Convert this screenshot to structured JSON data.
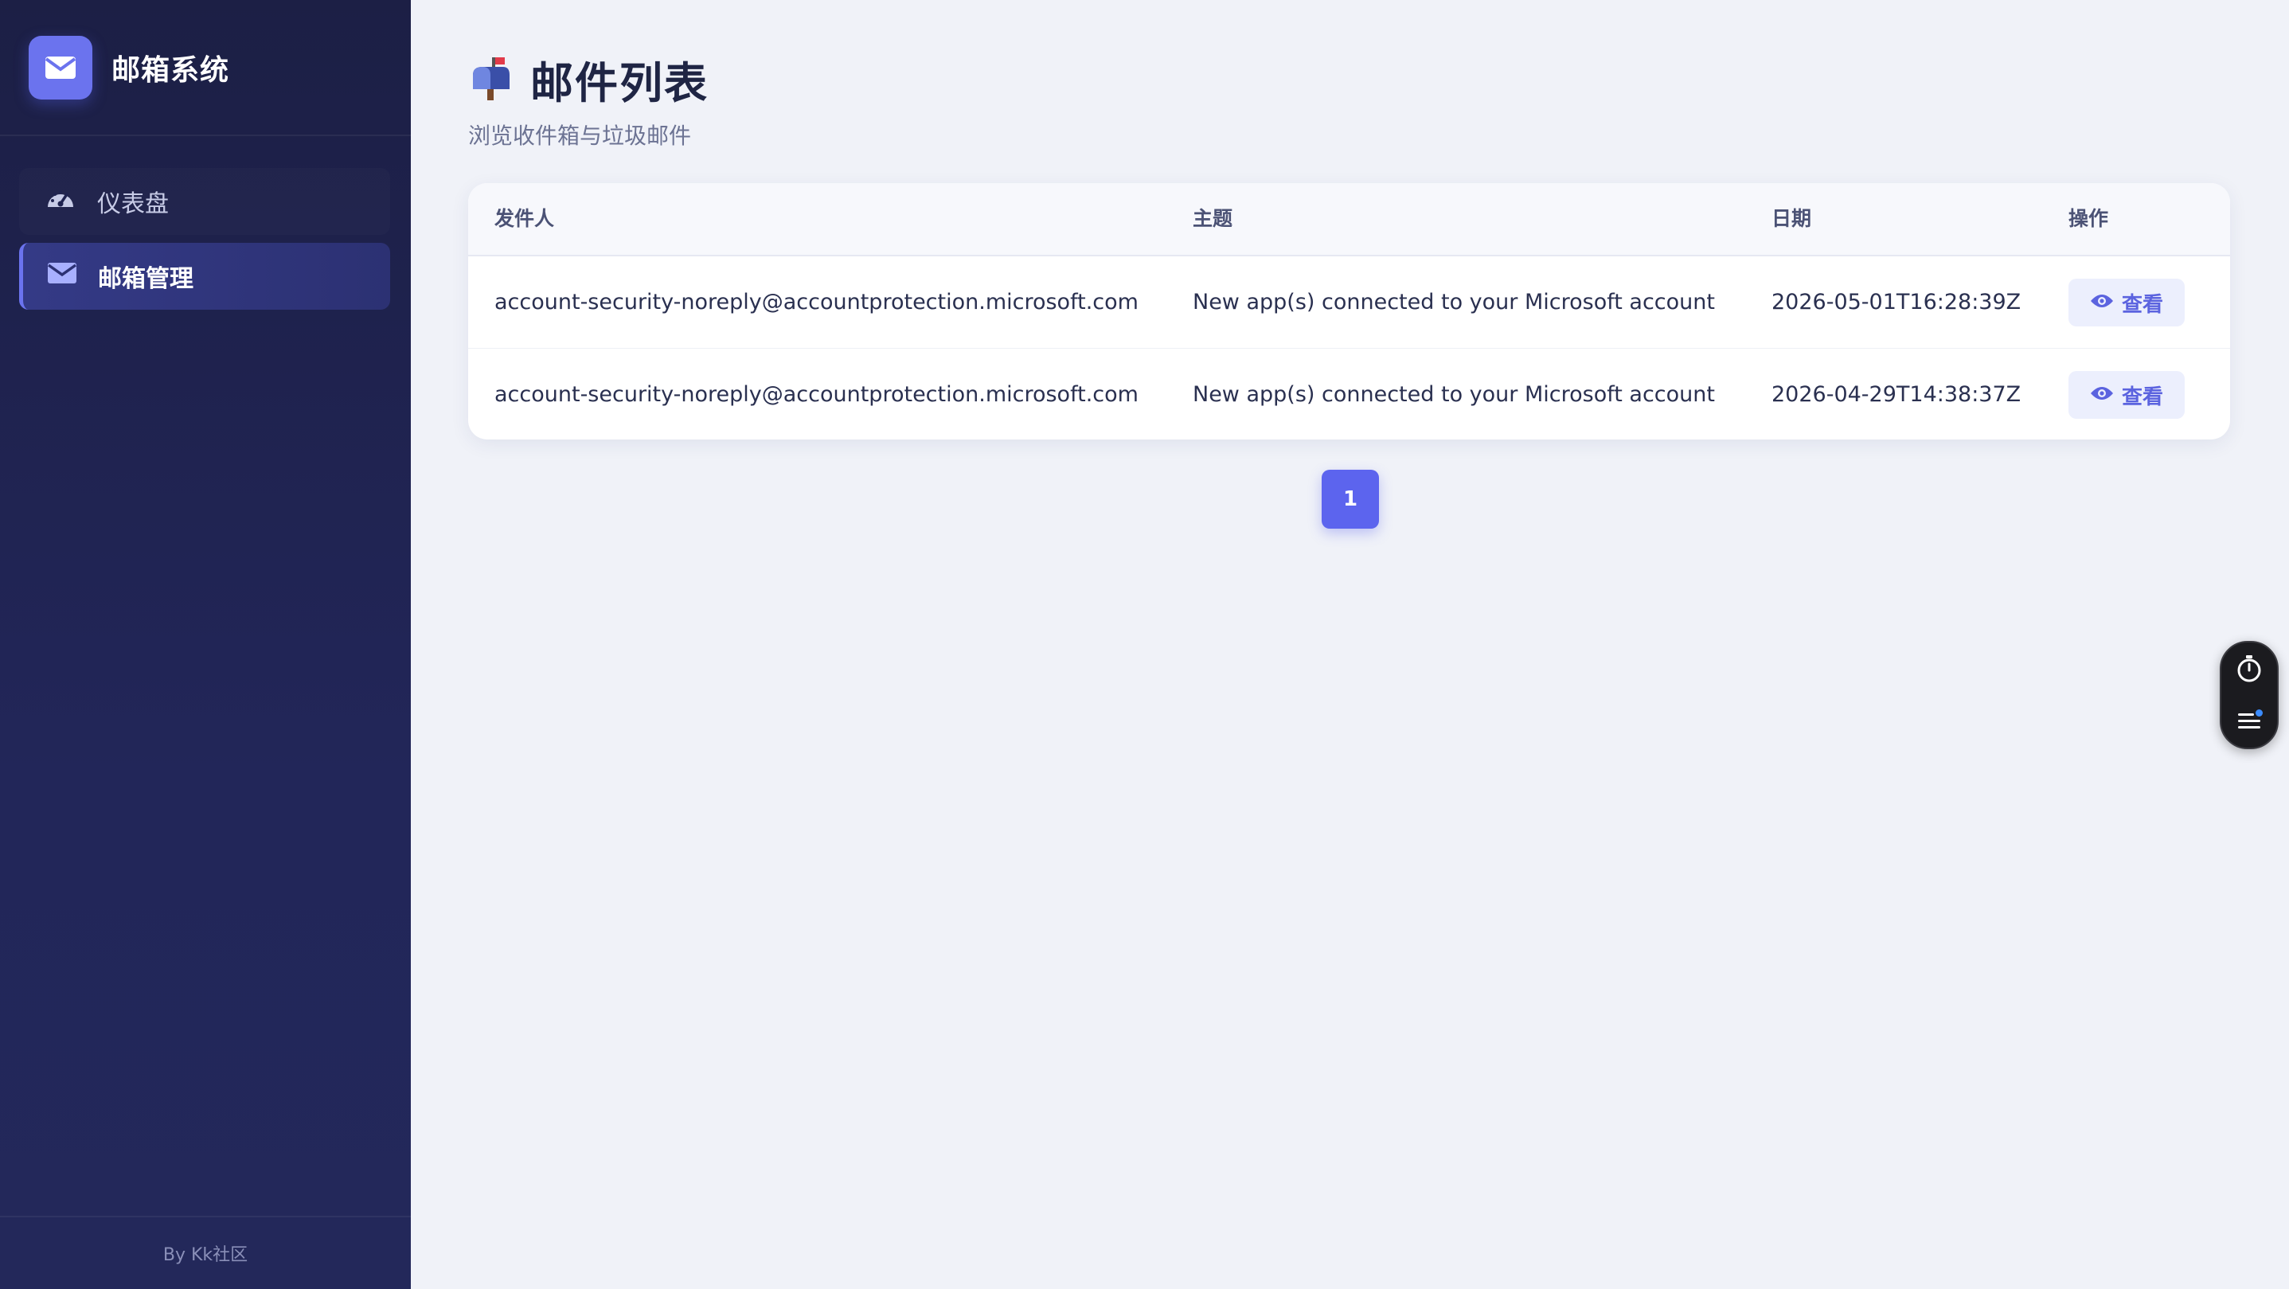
{
  "sidebar": {
    "brand_title": "邮箱系统",
    "items": [
      {
        "label": "仪表盘",
        "icon": "gauge-icon",
        "active": false
      },
      {
        "label": "邮箱管理",
        "icon": "envelope-icon",
        "active": true
      }
    ],
    "footer": "By Kk社区"
  },
  "header": {
    "title": "邮件列表",
    "subtitle": "浏览收件箱与垃圾邮件",
    "icon": "mailbox-icon"
  },
  "table": {
    "columns": [
      "发件人",
      "主题",
      "日期",
      "操作"
    ],
    "rows": [
      {
        "sender": "account-security-noreply@accountprotection.microsoft.com",
        "subject": "New app(s) connected to your Microsoft account",
        "date": "2026-05-01T16:28:39Z",
        "action": "查看"
      },
      {
        "sender": "account-security-noreply@accountprotection.microsoft.com",
        "subject": "New app(s) connected to your Microsoft account",
        "date": "2026-04-29T14:38:37Z",
        "action": "查看"
      }
    ]
  },
  "pagination": {
    "current_page": "1"
  },
  "colors": {
    "accent": "#5c64ee",
    "sidebar_bg": "#1c1f45",
    "page_bg": "#f0f2f8"
  },
  "floating_widget": {
    "icons": [
      "stopwatch-icon",
      "menu-list-icon"
    ]
  }
}
